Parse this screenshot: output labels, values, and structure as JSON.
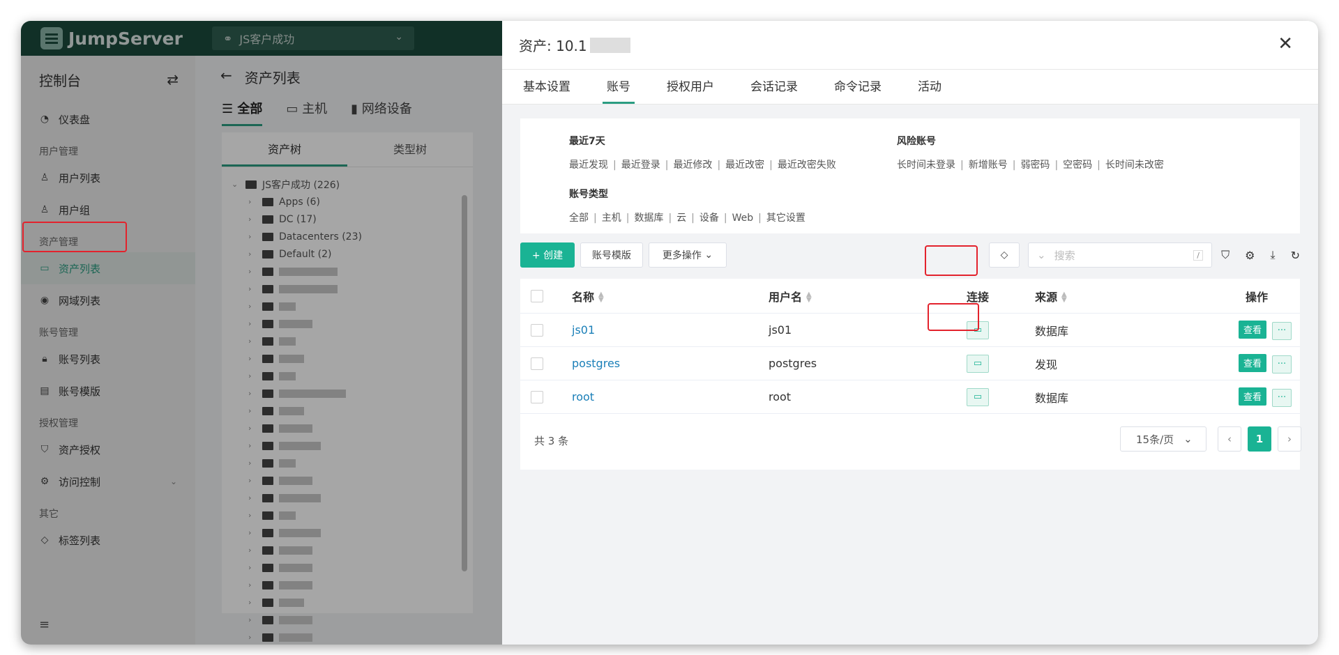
{
  "app": {
    "logo_text": "JumpServer",
    "org_name": "JS客户成功"
  },
  "sidebar": {
    "title": "控制台",
    "items": [
      {
        "type": "item",
        "label": "仪表盘",
        "icon": "dashboard-icon"
      },
      {
        "type": "group",
        "label": "用户管理"
      },
      {
        "type": "item",
        "label": "用户列表",
        "icon": "user-icon"
      },
      {
        "type": "item",
        "label": "用户组",
        "icon": "users-icon"
      },
      {
        "type": "group",
        "label": "资产管理"
      },
      {
        "type": "item",
        "label": "资产列表",
        "icon": "monitor-icon",
        "active": true
      },
      {
        "type": "item",
        "label": "网域列表",
        "icon": "location-icon"
      },
      {
        "type": "group",
        "label": "账号管理"
      },
      {
        "type": "item",
        "label": "账号列表",
        "icon": "lock-icon"
      },
      {
        "type": "item",
        "label": "账号模版",
        "icon": "template-icon"
      },
      {
        "type": "group",
        "label": "授权管理"
      },
      {
        "type": "item",
        "label": "资产授权",
        "icon": "shield-icon"
      },
      {
        "type": "item",
        "label": "访问控制",
        "icon": "gear-icon",
        "expandable": true
      },
      {
        "type": "group",
        "label": "其它"
      },
      {
        "type": "item",
        "label": "标签列表",
        "icon": "tag-icon"
      }
    ]
  },
  "main": {
    "title": "资产列表",
    "tabs": [
      "全部",
      "主机",
      "网络设备"
    ],
    "panel_tabs": [
      "资产树",
      "类型树"
    ],
    "tree_root": "JS客户成功 (226)",
    "tree_nodes": [
      "Apps (6)",
      "DC (17)",
      "Datacenters (23)",
      "Default (2)"
    ]
  },
  "drawer": {
    "title": "资产: 10.1",
    "tabs": [
      "基本设置",
      "账号",
      "授权用户",
      "会话记录",
      "命令记录",
      "活动"
    ],
    "active_tab": "账号",
    "filters": {
      "recent": {
        "title": "最近7天",
        "links": [
          "最近发现",
          "最近登录",
          "最近修改",
          "最近改密",
          "最近改密失败"
        ]
      },
      "risk": {
        "title": "风险账号",
        "links": [
          "长时间未登录",
          "新增账号",
          "弱密码",
          "空密码",
          "长时间未改密"
        ]
      },
      "types": {
        "title": "账号类型",
        "links": [
          "全部",
          "主机",
          "数据库",
          "云",
          "设备",
          "Web",
          "其它设置"
        ]
      }
    },
    "toolbar": {
      "create": "+ 创建",
      "template": "账号模版",
      "more": "更多操作",
      "search_placeholder": "搜索",
      "search_hint": "/"
    },
    "table": {
      "headers": {
        "name": "名称",
        "username": "用户名",
        "connect": "连接",
        "source": "来源",
        "actions": "操作"
      },
      "rows": [
        {
          "name": "js01",
          "username": "js01",
          "source": "数据库"
        },
        {
          "name": "postgres",
          "username": "postgres",
          "source": "发现"
        },
        {
          "name": "root",
          "username": "root",
          "source": "数据库"
        }
      ],
      "view_label": "查看",
      "more_label": "···"
    },
    "footer": {
      "total": "共 3 条",
      "page_size": "15条/页",
      "current_page": "1"
    }
  },
  "colors": {
    "brand": "#1ab394",
    "topbar": "#1b4b3c",
    "highlight": "#e3222c",
    "link": "#1a7fb8"
  }
}
